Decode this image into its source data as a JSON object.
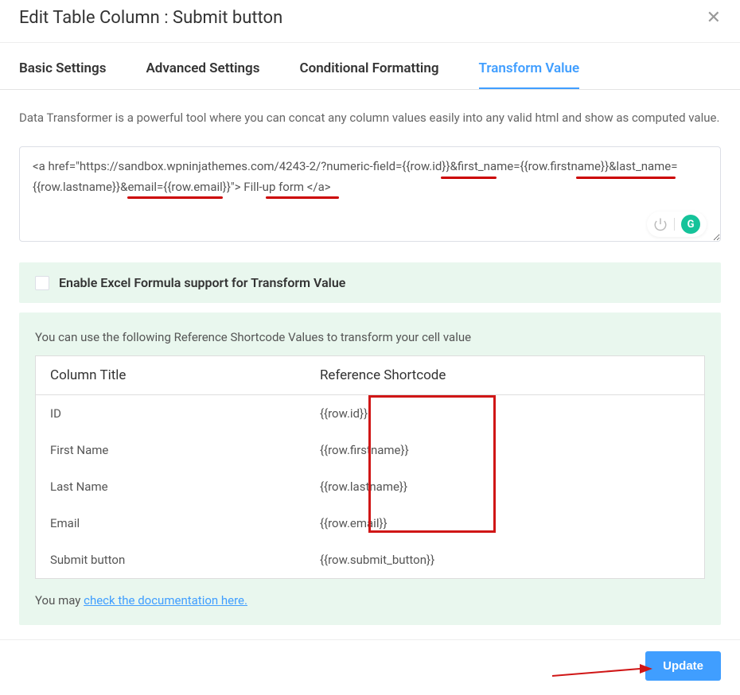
{
  "header": {
    "title": "Edit Table Column : Submit button"
  },
  "tabs": [
    {
      "label": "Basic Settings",
      "active": false
    },
    {
      "label": "Advanced Settings",
      "active": false
    },
    {
      "label": "Conditional Formatting",
      "active": false
    },
    {
      "label": "Transform Value",
      "active": true
    }
  ],
  "description": "Data Transformer is a powerful tool where you can concat any column values easily into any valid html and show as computed value.",
  "code_value": "<a href=\"https://sandbox.wpninjathemes.com/4243-2/?numeric-field={{row.id}}&first_name={{row.firstname}}&last_name={{row.lastname}}&email={{row.email}}\"> Fill-up form </a>",
  "formula_checkbox_label": "Enable Excel Formula support for Transform Value",
  "reference": {
    "intro": "You can use the following Reference Shortcode Values to transform your cell value",
    "headers": {
      "col1": "Column Title",
      "col2": "Reference Shortcode"
    },
    "rows": [
      {
        "title": "ID",
        "shortcode": "{{row.id}}"
      },
      {
        "title": "First Name",
        "shortcode": "{{row.firstname}}"
      },
      {
        "title": "Last Name",
        "shortcode": "{{row.lastname}}"
      },
      {
        "title": "Email",
        "shortcode": "{{row.email}}"
      },
      {
        "title": "Submit button",
        "shortcode": "{{row.submit_button}}"
      }
    ],
    "doc_prefix": "You may ",
    "doc_link_text": "check the documentation here."
  },
  "footer": {
    "update_label": "Update"
  },
  "grammarly_letter": "G"
}
